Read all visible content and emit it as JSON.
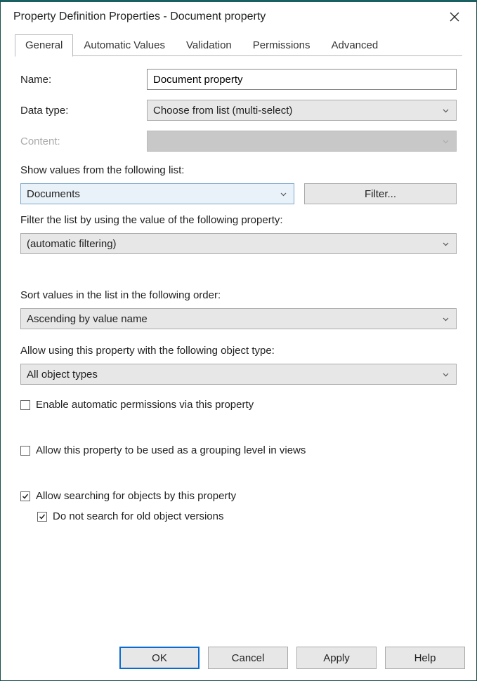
{
  "window": {
    "title": "Property Definition Properties - Document property"
  },
  "tabs": {
    "general": "General",
    "automatic": "Automatic Values",
    "validation": "Validation",
    "permissions": "Permissions",
    "advanced": "Advanced"
  },
  "labels": {
    "name": "Name:",
    "data_type": "Data type:",
    "content": "Content:",
    "show_values": "Show values from the following list:",
    "filter_list": "Filter the list by using the value of the following property:",
    "sort_values": "Sort values in the list in the following order:",
    "allow_object_type": "Allow using this property with the following object type:"
  },
  "fields": {
    "name_value": "Document property",
    "data_type_value": "Choose from list (multi-select)",
    "content_value": "",
    "values_list": "Documents",
    "filter_button": "Filter...",
    "filter_property": "(automatic filtering)",
    "sort_order": "Ascending by value name",
    "object_type": "All object types"
  },
  "checkboxes": {
    "enable_perms": "Enable automatic permissions via this property",
    "allow_grouping": "Allow this property to be used as a grouping level in views",
    "allow_search": "Allow searching for objects by this property",
    "no_old_versions": "Do not search for old object versions"
  },
  "buttons": {
    "ok": "OK",
    "cancel": "Cancel",
    "apply": "Apply",
    "help": "Help"
  }
}
